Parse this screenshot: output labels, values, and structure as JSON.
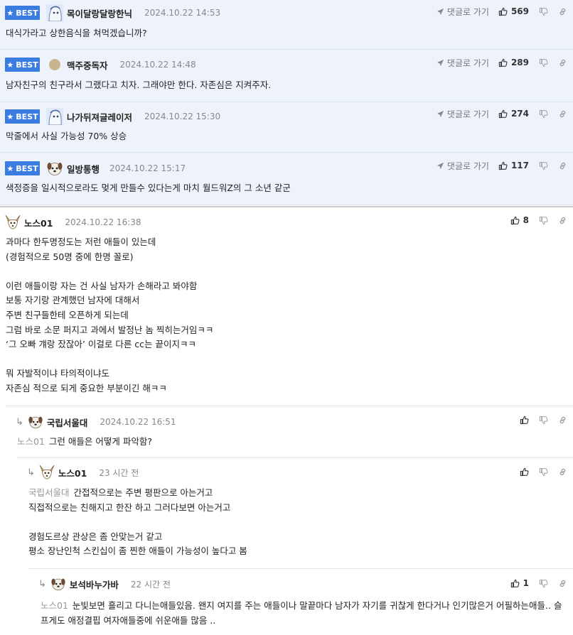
{
  "colors": {
    "best_bg": "#eef3fb",
    "badge": "#3b7ce1"
  },
  "labels": {
    "best": "BEST",
    "goto": "댓글로 가기"
  },
  "icons": [
    "star-icon",
    "send-arrow-icon",
    "thumbs-up-icon",
    "thumbs-down-icon",
    "link-icon",
    "reply-arrow-icon"
  ],
  "best_comments": [
    {
      "nick": "목이달랑달랑한닉",
      "time": "2024.10.22 14:53",
      "likes": "569",
      "text": "대식가라고 상한음식을 쳐먹겠습니까?",
      "avatar": "character"
    },
    {
      "nick": "맥주중독자",
      "time": "2024.10.22 14:48",
      "likes": "289",
      "text": "남자친구의 친구라서 그랬다고 치자. 그래야만 한다. 자존심은 지켜주자.",
      "avatar": "dot"
    },
    {
      "nick": "나가뒤져글레이저",
      "time": "2024.10.22 15:30",
      "likes": "274",
      "text": "막줄에서 사실 가능성 70% 상승",
      "avatar": "character"
    },
    {
      "nick": "일방통행",
      "time": "2024.10.22 15:17",
      "likes": "117",
      "text": "색정증을 일시적으로라도 멎게 만들수 있다는게 마치 월드워Z의 그 소년 같군",
      "avatar": "dog"
    }
  ],
  "comments": [
    {
      "nick": "노스01",
      "time": "2024.10.22 16:38",
      "likes": "8",
      "text": "과마다 한두명정도는 저런 애들이 있는데\n(경험적으로 50명 중에 한명 꼴로)\n\n이런 애들이랑 자는 건 사실 남자가 손해라고 봐야함\n보통 자기랑 관계했던 남자에 대해서\n주변 친구들한테 오픈하게 되는데\n그럼 바로 소문 퍼지고 과에서 발정난 놈 찍히는거임ㅋㅋ\n‘그 오빠 걔랑 잤잖아’ 이걸로 다른 cc는 끝이지ㅋㅋ\n\n뭐 자발적이냐 타의적이냐도\n자존심 적으로 되게 중요한 부분이긴 해ㅋㅋ"
    },
    {
      "nick": "국립서울대",
      "time": "2024.10.22 16:51",
      "likes": "",
      "mention": "노스01",
      "text": "그런 애들은 어떻게 파악함?"
    },
    {
      "nick": "노스01",
      "time": "23 시간 전",
      "likes": "",
      "mention": "국립서울대",
      "text": "간접적으로는 주변 평판으로 아는거고\n직접적으로는 친해지고 한잔 하고 그러다보면 아는거고\n\n경험도르상 관상은 좀 안맞는거 같고\n평소 장난인척 스킨십이 좀 찐한 애들이 가능성이 높다고 봄"
    },
    {
      "nick": "보석바누가바",
      "time": "22 시간 전",
      "likes": "1",
      "mention": "노스01",
      "text": "눈빛보면 흘리고 다니는애들있음. 왠지 여지를 주는 애들이나 말끝마다 남자가 자기를 귀찮게 한다거나 인기많은거 어필하는애들.. 슬프게도 애정결핍 여자애들중에 쉬운애들 많음 .."
    }
  ]
}
